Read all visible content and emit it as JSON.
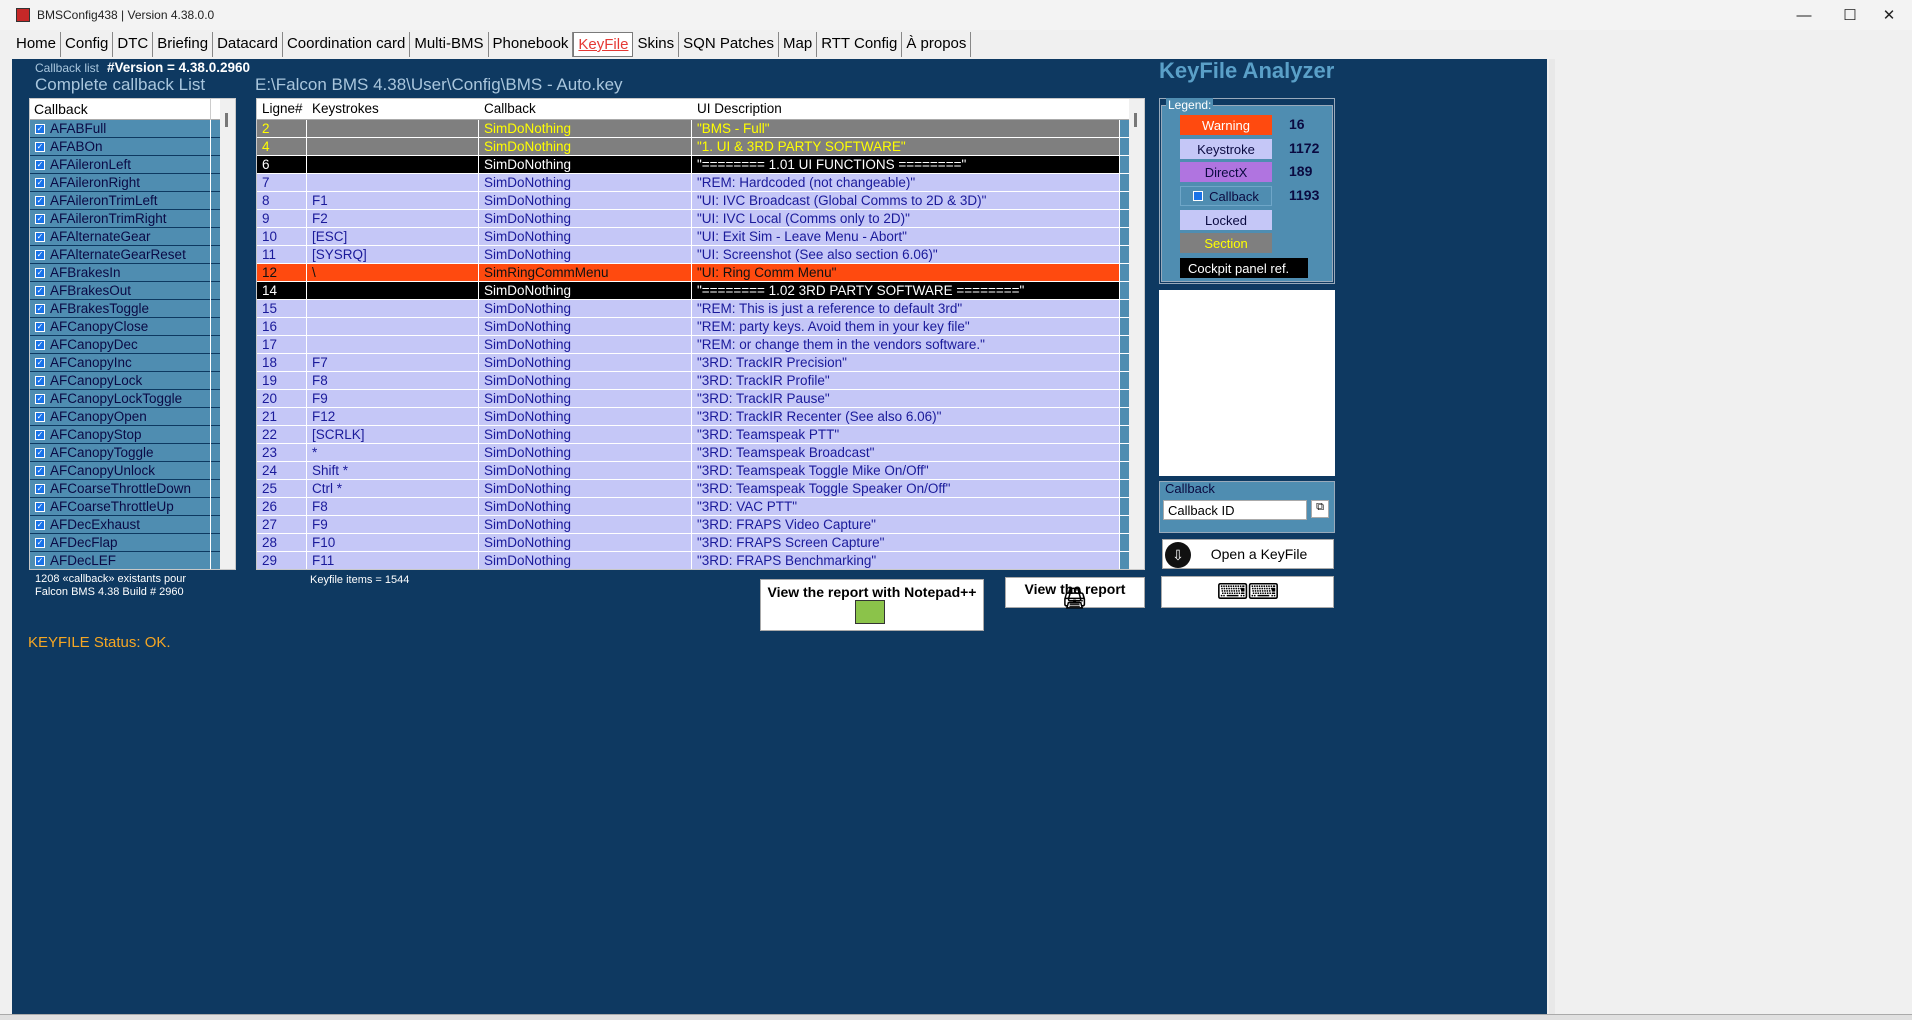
{
  "window": {
    "title": "BMSConfig438 | Version 4.38.0.0",
    "minimize": "—",
    "maximize": "☐",
    "close": "✕"
  },
  "tabs": [
    "Home",
    "Config",
    "DTC",
    "Briefing",
    "Datacard",
    "Coordination card",
    "Multi-BMS",
    "Phonebook",
    "KeyFile",
    "Skins",
    "SQN Patches",
    "Map",
    "RTT Config",
    "À propos"
  ],
  "active_tab": "KeyFile",
  "header": {
    "callback_list_label": "Callback list",
    "version": "#Version = 4.38.0.2960",
    "complete_list": "Complete callback List",
    "file_path": "E:\\Falcon BMS 4.38\\User\\Config\\BMS - Auto.key",
    "analyzer_title": "KeyFile Analyzer"
  },
  "callback_list": {
    "header": "Callback",
    "items": [
      "AFABFull",
      "AFABOn",
      "AFAileronLeft",
      "AFAileronRight",
      "AFAileronTrimLeft",
      "AFAileronTrimRight",
      "AFAlternateGear",
      "AFAlternateGearReset",
      "AFBrakesIn",
      "AFBrakesOut",
      "AFBrakesToggle",
      "AFCanopyClose",
      "AFCanopyDec",
      "AFCanopyInc",
      "AFCanopyLock",
      "AFCanopyLockToggle",
      "AFCanopyOpen",
      "AFCanopyStop",
      "AFCanopyToggle",
      "AFCanopyUnlock",
      "AFCoarseThrottleDown",
      "AFCoarseThrottleUp",
      "AFDecExhaust",
      "AFDecFlap",
      "AFDecLEF"
    ],
    "footer_line1": "1208 «callback» existants pour",
    "footer_line2": "Falcon BMS 4.38 Build # 2960"
  },
  "grid": {
    "columns": [
      "Ligne#",
      "Keystrokes",
      "Callback",
      "UI Description"
    ],
    "rows": [
      {
        "n": "2",
        "k": "",
        "cb": "SimDoNothing",
        "d": "\"BMS - Full\"",
        "type": "section"
      },
      {
        "n": "4",
        "k": "",
        "cb": "SimDoNothing",
        "d": "\"1. UI & 3RD PARTY SOFTWARE\"",
        "type": "section"
      },
      {
        "n": "6",
        "k": "",
        "cb": "SimDoNothing",
        "d": "\"======== 1.01     UI FUNCTIONS ========\"",
        "type": "cockpit"
      },
      {
        "n": "7",
        "k": "",
        "cb": "SimDoNothing",
        "d": "\"REM: Hardcoded (not changeable)\"",
        "type": "normal"
      },
      {
        "n": "8",
        "k": "F1",
        "cb": "SimDoNothing",
        "d": "\"UI: IVC Broadcast (Global Comms to 2D & 3D)\"",
        "type": "normal"
      },
      {
        "n": "9",
        "k": "F2",
        "cb": "SimDoNothing",
        "d": "\"UI: IVC Local (Comms only to 2D)\"",
        "type": "normal"
      },
      {
        "n": "10",
        "k": "[ESC]",
        "cb": "SimDoNothing",
        "d": "\"UI: Exit Sim - Leave Menu - Abort\"",
        "type": "normal"
      },
      {
        "n": "11",
        "k": "[SYSRQ]",
        "cb": "SimDoNothing",
        "d": "\"UI: Screenshot (See also section 6.06)\"",
        "type": "normal"
      },
      {
        "n": "12",
        "k": "\\",
        "cb": "SimRingCommMenu",
        "d": "\"UI: Ring Comm Menu\"",
        "type": "warning"
      },
      {
        "n": "14",
        "k": "",
        "cb": "SimDoNothing",
        "d": "\"======== 1.02     3RD PARTY SOFTWARE ========\"",
        "type": "cockpit"
      },
      {
        "n": "15",
        "k": "",
        "cb": "SimDoNothing",
        "d": "\"REM: This is just a reference to default 3rd\"",
        "type": "normal"
      },
      {
        "n": "16",
        "k": "",
        "cb": "SimDoNothing",
        "d": "\"REM: party keys. Avoid them in your key file\"",
        "type": "normal"
      },
      {
        "n": "17",
        "k": "",
        "cb": "SimDoNothing",
        "d": "\"REM: or change them in the vendors software.\"",
        "type": "normal"
      },
      {
        "n": "18",
        "k": "F7",
        "cb": "SimDoNothing",
        "d": "\"3RD: TrackIR Precision\"",
        "type": "normal"
      },
      {
        "n": "19",
        "k": "F8",
        "cb": "SimDoNothing",
        "d": "\"3RD: TrackIR Profile\"",
        "type": "normal"
      },
      {
        "n": "20",
        "k": "F9",
        "cb": "SimDoNothing",
        "d": "\"3RD: TrackIR Pause\"",
        "type": "normal"
      },
      {
        "n": "21",
        "k": "F12",
        "cb": "SimDoNothing",
        "d": "\"3RD: TrackIR Recenter (See also 6.06)\"",
        "type": "normal"
      },
      {
        "n": "22",
        "k": "[SCRLK]",
        "cb": "SimDoNothing",
        "d": "\"3RD: Teamspeak PTT\"",
        "type": "normal"
      },
      {
        "n": "23",
        "k": "*",
        "cb": "SimDoNothing",
        "d": "\"3RD: Teamspeak Broadcast\"",
        "type": "normal"
      },
      {
        "n": "24",
        "k": "Shift *",
        "cb": "SimDoNothing",
        "d": "\"3RD: Teamspeak Toggle Mike On/Off\"",
        "type": "normal"
      },
      {
        "n": "25",
        "k": "Ctrl *",
        "cb": "SimDoNothing",
        "d": "\"3RD: Teamspeak Toggle Speaker On/Off\"",
        "type": "normal"
      },
      {
        "n": "26",
        "k": "F8",
        "cb": "SimDoNothing",
        "d": "\"3RD: VAC PTT\"",
        "type": "normal"
      },
      {
        "n": "27",
        "k": "F9",
        "cb": "SimDoNothing",
        "d": "\"3RD: FRAPS Video Capture\"",
        "type": "normal"
      },
      {
        "n": "28",
        "k": "F10",
        "cb": "SimDoNothing",
        "d": "\"3RD: FRAPS Screen Capture\"",
        "type": "normal"
      },
      {
        "n": "29",
        "k": "F11",
        "cb": "SimDoNothing",
        "d": "\"3RD: FRAPS Benchmarking\"",
        "type": "normal"
      }
    ],
    "footer": "Keyfile items = 1544"
  },
  "legend": {
    "title": "Legend:",
    "warning": "Warning",
    "warning_count": "16",
    "keystroke": "Keystroke",
    "keystroke_count": "1172",
    "directx": "DirectX",
    "directx_count": "189",
    "callback": "Callback",
    "callback_count": "1193",
    "locked": "Locked",
    "section": "Section",
    "cockpit": "Cockpit panel ref."
  },
  "callback_group": {
    "title": "Callback",
    "input_value": "Callback ID"
  },
  "buttons": {
    "open_keyfile": "Open a KeyFile",
    "view_notepad": "View the report with Notepad++",
    "view_report": "View the report"
  },
  "status": "KEYFILE Status: OK.",
  "colors": {
    "panel_bg": "#0e3961",
    "normal_row": "#c5c7f7",
    "section_row": "#7f7f7f",
    "cockpit_row": "#000000",
    "warning_row": "#ff4a0f",
    "status_text": "#f5a623"
  }
}
